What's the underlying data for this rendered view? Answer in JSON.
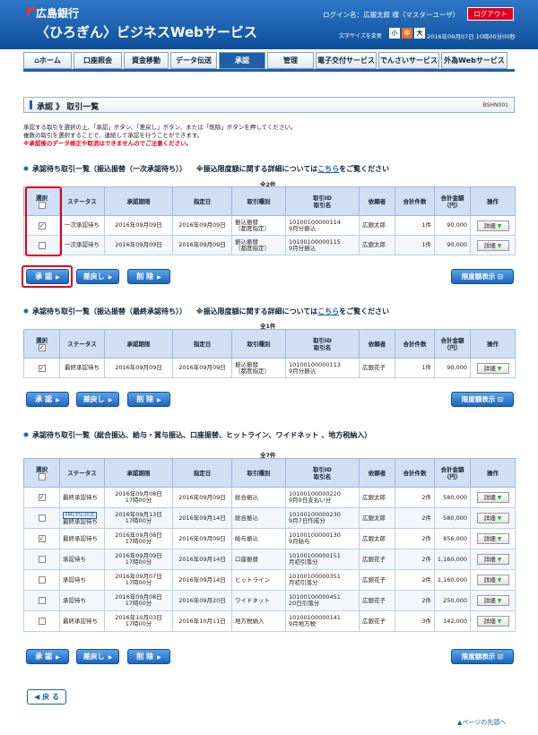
{
  "header": {
    "bank_name": "広島銀行",
    "service_name": "〈ひろぎん〉ビジネスWebサービス",
    "login_text": "ログイン名：広銀太郎 様（マスターユーザ）",
    "logout_label": "ログアウト",
    "font_size_label": "文字サイズを変更",
    "font_small": "小",
    "font_medium": "中",
    "font_large": "大",
    "datetime": "2016年09月07日 10時00分00秒"
  },
  "nav": {
    "tabs": [
      "ホーム",
      "口座照会",
      "資金移動",
      "データ伝送",
      "承認",
      "管理",
      "電子交付サービス",
      "でんさいサービス",
      "外為Webサービス"
    ],
    "active": "承認"
  },
  "page": {
    "title": "承認 》 取引一覧",
    "screen_id": "BSHN001",
    "intro_line1": "承認する取引を選択の上、「承認」ボタン、「差戻し」ボタン、または「削除」ボタンを押してください。",
    "intro_line2": "複数の取引を選択することで、連続して承認を行うことができます。",
    "intro_warning": "※承認後のデータ修正や取消はできませんのでご注意ください。"
  },
  "columns": {
    "select": "選択",
    "status": "ステータス",
    "deadline": "承認期限",
    "date": "指定日",
    "type": "取引種別",
    "id_line1": "取引ID",
    "id_line2": "取引名",
    "requester": "依頼者",
    "count": "合計件数",
    "amount_line1": "合計金額",
    "amount_line2": "（円）",
    "action": "操作"
  },
  "detail_label": "詳細",
  "buttons": {
    "approve": "承 認",
    "return": "差戻し",
    "delete": "削 除",
    "limit": "限度額表示",
    "back": "戻 る",
    "page_top": "ページの先頭へ"
  },
  "sections": [
    {
      "title": "承認待ち取引一覧（振込振替（一次承認待ち））",
      "note_pre": "※振込限度額に関する詳細については",
      "note_link": "こちら",
      "note_post": "をご覧ください",
      "count": "全2件",
      "rows": [
        {
          "checked": true,
          "status": "一次承認待ち",
          "deadline": "2016年09月09日",
          "date": "2016年09月09日",
          "type_1": "振込振替",
          "type_2": "（都度指定）",
          "id": "10100100000114",
          "name": "9月分振込",
          "requester": "広銀太郎",
          "count": "1件",
          "amount": "90,000"
        },
        {
          "checked": false,
          "status": "一次承認待ち",
          "deadline": "2016年09月09日",
          "date": "2016年09月09日",
          "type_1": "振込振替",
          "type_2": "（都度指定）",
          "id": "10100100000115",
          "name": "9月分振込",
          "requester": "広銀太郎",
          "count": "1件",
          "amount": "90,000"
        }
      ]
    },
    {
      "title": "承認待ち取引一覧（振込振替（最終承認待ち））",
      "note_pre": "※振込限度額に関する詳細については",
      "note_link": "こちら",
      "note_post": "をご覧ください",
      "count": "全1件",
      "rows": [
        {
          "checked": true,
          "status": "最終承認待ち",
          "deadline": "2016年09月09日",
          "date": "2016年09月09日",
          "type_1": "振込振替",
          "type_2": "（都度指定）",
          "id": "10100100000113",
          "name": "9月分振込",
          "requester": "広銀花子",
          "count": "1件",
          "amount": "90,000"
        }
      ]
    },
    {
      "title": "承認待ち取引一覧（総合振込、給与・賞与振込、口座振替、ヒットライン、ワイドネット 、地方税納入）",
      "count": "全7件",
      "rows": [
        {
          "checked": true,
          "status": "最終承認待ち",
          "tag": "",
          "deadline_1": "2016年09月08日",
          "deadline_2": "17時00分",
          "date": "2016年09月09日",
          "type": "総合振込",
          "id": "10100100000220",
          "name": "9月9日支払い分",
          "requester": "広銀太郎",
          "count": "2件",
          "amount": "580,000"
        },
        {
          "checked": false,
          "status": "",
          "tag": "XML対応形式",
          "status_2": "最終承認待ち",
          "deadline_1": "2016年09月13日",
          "deadline_2": "17時00分",
          "date": "2016年09月14日",
          "type": "総合振込",
          "id": "10100100000230",
          "name": "9月7日作成分",
          "requester": "広銀太郎",
          "count": "2件",
          "amount": "580,000"
        },
        {
          "checked": true,
          "status": "最終承認待ち",
          "tag": "",
          "deadline_1": "2016年09月08日",
          "deadline_2": "17時00分",
          "date": "2016年09月09日",
          "type": "給与振込",
          "id": "10100100000130",
          "name": "9月給与",
          "requester": "広銀太郎",
          "count": "2件",
          "amount": "856,000"
        },
        {
          "checked": false,
          "status": "承認待ち",
          "tag": "",
          "deadline_1": "2016年09月09日",
          "deadline_2": "17時00分",
          "date": "2016年09月14日",
          "type": "口座振替",
          "id": "10100100000151",
          "name": "月初引落分",
          "requester": "広銀花子",
          "count": "2件",
          "amount": "1,160,000"
        },
        {
          "checked": false,
          "status": "承認待ち",
          "tag": "",
          "deadline_1": "2016年09月07日",
          "deadline_2": "17時00分",
          "date": "2016年09月14日",
          "type": "ヒットライン",
          "id": "10100100000351",
          "name": "月初引落分",
          "requester": "広銀花子",
          "count": "2件",
          "amount": "1,160,000"
        },
        {
          "checked": false,
          "status": "承認待ち",
          "tag": "",
          "deadline_1": "2016年09月08日",
          "deadline_2": "17時00分",
          "date": "2016年09月20日",
          "type": "ワイドネット",
          "id": "10100100000451",
          "name": "20日引落分",
          "requester": "広銀花子",
          "count": "2件",
          "amount": "250,000"
        },
        {
          "checked": false,
          "status": "最終承認待ち",
          "tag": "",
          "deadline_1": "2016年10月03日",
          "deadline_2": "17時00分",
          "date": "2016年10月11日",
          "type": "地方税納入",
          "id": "10100100000141",
          "name": "9月地方税",
          "requester": "広銀花子",
          "count": "3件",
          "amount": "142,000"
        }
      ]
    }
  ]
}
